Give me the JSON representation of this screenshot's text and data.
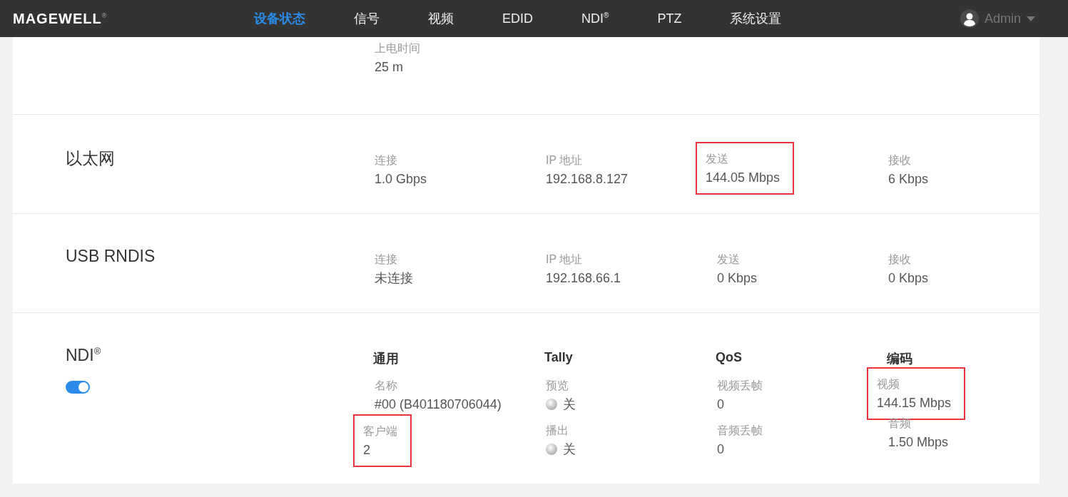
{
  "nav": {
    "logo": "MAGEWELL$^{®}$",
    "items": [
      {
        "label": "设备状态",
        "selected": true
      },
      {
        "label": "信号",
        "selected": false
      },
      {
        "label": "视频",
        "selected": false
      },
      {
        "label": "EDID",
        "selected": false
      },
      {
        "label": "NDI$^{®}$",
        "selected": false
      },
      {
        "label": "PTZ",
        "selected": false
      },
      {
        "label": "系统设置",
        "selected": false
      }
    ],
    "user": "Admin"
  },
  "sections": [
    {
      "columns": [
        {
          "fields": [
            {
              "kind": "text",
              "label": "上电时间",
              "value": "25 m",
              "highlighted": false
            }
          ]
        }
      ]
    },
    {
      "title": "以太网",
      "columns": [
        {
          "fields": [
            {
              "kind": "text",
              "label": "连接",
              "value": "1.0 Gbps",
              "highlighted": false
            }
          ]
        },
        {
          "fields": [
            {
              "kind": "text",
              "label": "IP 地址",
              "value": "192.168.8.127",
              "highlighted": false
            }
          ]
        },
        {
          "fields": [
            {
              "kind": "text",
              "label": "发送",
              "value": "144.05 Mbps",
              "highlighted": true
            }
          ]
        },
        {
          "fields": [
            {
              "kind": "text",
              "label": "接收",
              "value": "6 Kbps",
              "highlighted": false
            }
          ]
        }
      ]
    },
    {
      "title": "USB RNDIS",
      "columns": [
        {
          "fields": [
            {
              "kind": "text",
              "label": "连接",
              "value": "未连接",
              "highlighted": false
            }
          ]
        },
        {
          "fields": [
            {
              "kind": "text",
              "label": "IP 地址",
              "value": "192.168.66.1",
              "highlighted": false
            }
          ]
        },
        {
          "fields": [
            {
              "kind": "text",
              "label": "发送",
              "value": "0 Kbps",
              "highlighted": false
            }
          ]
        },
        {
          "fields": [
            {
              "kind": "text",
              "label": "接收",
              "value": "0 Kbps",
              "highlighted": false
            }
          ]
        }
      ]
    },
    {
      "title": "NDI$^{®}$",
      "toggle": {
        "on": true
      },
      "columns": [
        {
          "heading": "通用",
          "fields": [
            {
              "kind": "text",
              "label": "名称",
              "value": "#00 (B401180706044)",
              "highlighted": false
            },
            {
              "kind": "text",
              "label": "客户端",
              "value": "2",
              "highlighted": true
            }
          ]
        },
        {
          "heading": "Tally",
          "fields": [
            {
              "kind": "indicator",
              "label": "预览",
              "value": "关",
              "on": false,
              "highlighted": false
            },
            {
              "kind": "indicator",
              "label": "播出",
              "value": "关",
              "on": false,
              "highlighted": false
            }
          ]
        },
        {
          "heading": "QoS",
          "fields": [
            {
              "kind": "text",
              "label": "视频丢帧",
              "value": "0",
              "highlighted": false
            },
            {
              "kind": "text",
              "label": "音频丢帧",
              "value": "0",
              "highlighted": false
            }
          ]
        },
        {
          "heading": "编码",
          "fields": [
            {
              "kind": "text",
              "label": "视频",
              "value": "144.15 Mbps",
              "highlighted": true
            },
            {
              "kind": "text",
              "label": "音频",
              "value": "1.50 Mbps",
              "highlighted": false
            }
          ]
        }
      ]
    }
  ]
}
